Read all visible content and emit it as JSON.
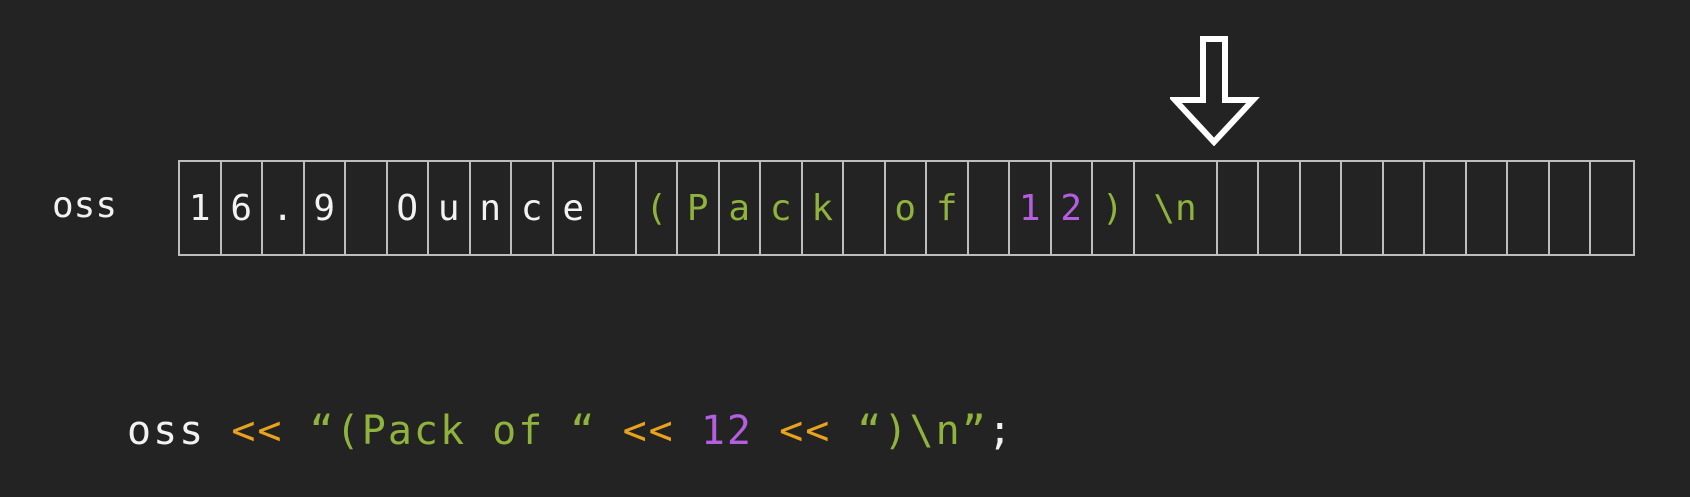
{
  "colors": {
    "background": "#232323",
    "text": "#f2f2f2",
    "string": "#8fb33c",
    "number": "#b45ee0",
    "operator": "#e8a21c",
    "grid": "#bdbdbd"
  },
  "stream_label": "oss",
  "arrow_icon": "down-arrow-outline",
  "cells": [
    {
      "ch": "1",
      "kind": "text"
    },
    {
      "ch": "6",
      "kind": "text"
    },
    {
      "ch": ".",
      "kind": "text"
    },
    {
      "ch": "9",
      "kind": "text"
    },
    {
      "ch": " ",
      "kind": "text"
    },
    {
      "ch": "O",
      "kind": "text"
    },
    {
      "ch": "u",
      "kind": "text"
    },
    {
      "ch": "n",
      "kind": "text"
    },
    {
      "ch": "c",
      "kind": "text"
    },
    {
      "ch": "e",
      "kind": "text"
    },
    {
      "ch": " ",
      "kind": "text"
    },
    {
      "ch": "(",
      "kind": "string"
    },
    {
      "ch": "P",
      "kind": "string"
    },
    {
      "ch": "a",
      "kind": "string"
    },
    {
      "ch": "c",
      "kind": "string"
    },
    {
      "ch": "k",
      "kind": "string"
    },
    {
      "ch": " ",
      "kind": "string"
    },
    {
      "ch": "o",
      "kind": "string"
    },
    {
      "ch": "f",
      "kind": "string"
    },
    {
      "ch": " ",
      "kind": "string"
    },
    {
      "ch": "1",
      "kind": "number"
    },
    {
      "ch": "2",
      "kind": "number"
    },
    {
      "ch": ")",
      "kind": "string"
    },
    {
      "ch": "\\n",
      "kind": "string",
      "wide": true
    },
    {
      "ch": "",
      "kind": "text"
    },
    {
      "ch": "",
      "kind": "text"
    },
    {
      "ch": "",
      "kind": "text"
    },
    {
      "ch": "",
      "kind": "text"
    },
    {
      "ch": "",
      "kind": "text"
    },
    {
      "ch": "",
      "kind": "text"
    },
    {
      "ch": "",
      "kind": "text"
    },
    {
      "ch": "",
      "kind": "text"
    },
    {
      "ch": "",
      "kind": "text"
    },
    {
      "ch": "",
      "kind": "text"
    }
  ],
  "code": [
    {
      "t": "oss ",
      "kind": "text"
    },
    {
      "t": "<<",
      "kind": "operator"
    },
    {
      "t": " “(Pack of “ ",
      "kind": "string"
    },
    {
      "t": "<<",
      "kind": "operator"
    },
    {
      "t": " ",
      "kind": "text"
    },
    {
      "t": "12",
      "kind": "number"
    },
    {
      "t": " ",
      "kind": "text"
    },
    {
      "t": "<<",
      "kind": "operator"
    },
    {
      "t": " “)\\n”",
      "kind": "string"
    },
    {
      "t": ";",
      "kind": "text"
    }
  ]
}
